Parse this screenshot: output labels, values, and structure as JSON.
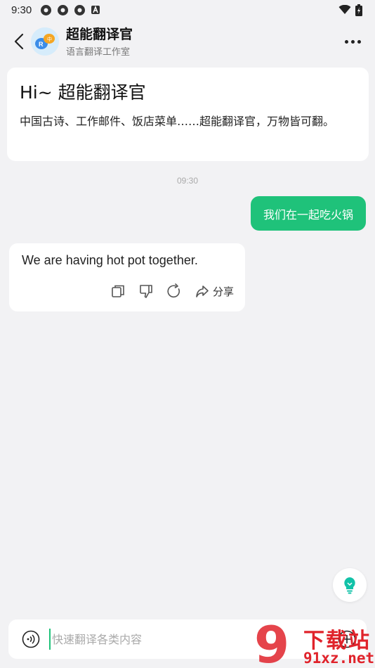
{
  "status_bar": {
    "time": "9:30",
    "notification_icons": [
      "sync-icon",
      "sync-icon",
      "sync-icon",
      "a-badge-icon"
    ],
    "right_icons": [
      "wifi-icon",
      "battery-icon"
    ]
  },
  "header": {
    "title": "超能翻译官",
    "subtitle": "语言翻译工作室",
    "back_icon": "chevron-left-icon",
    "more_icon": "more-dots-icon"
  },
  "welcome": {
    "greeting": "Hi~ 超能翻译官",
    "description": "中国古诗、工作邮件、饭店菜单……超能翻译官，万物皆可翻。"
  },
  "chat": {
    "timestamp": "09:30",
    "user_message": "我们在一起吃火锅",
    "bot_reply": "We are having hot pot together.",
    "actions": {
      "copy_icon": "copy-icon",
      "dislike_icon": "thumbs-down-icon",
      "regenerate_icon": "refresh-icon",
      "share_icon": "share-icon",
      "share_label": "分享"
    }
  },
  "input_bar": {
    "placeholder": "快速翻译各类内容",
    "voice_icon": "voice-icon",
    "plus_icon": "plus-circle-icon"
  },
  "floating": {
    "bulb_icon": "lightbulb-icon"
  },
  "watermark": {
    "brand": "下载站",
    "url": "91xz.net",
    "mark": "9"
  },
  "colors": {
    "accent": "#1fc27a",
    "background": "#f2f2f4",
    "watermark": "#e0232b"
  }
}
